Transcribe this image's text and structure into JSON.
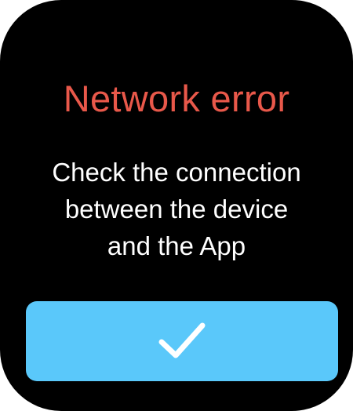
{
  "dialog": {
    "title": "Network error",
    "message": "Check the connection\nbetween the device\nand the App",
    "confirm_icon": "checkmark-icon"
  },
  "colors": {
    "background": "#000000",
    "title": "#e8584a",
    "message": "#ffffff",
    "button": "#5ac8fa",
    "button_icon": "#ffffff"
  }
}
